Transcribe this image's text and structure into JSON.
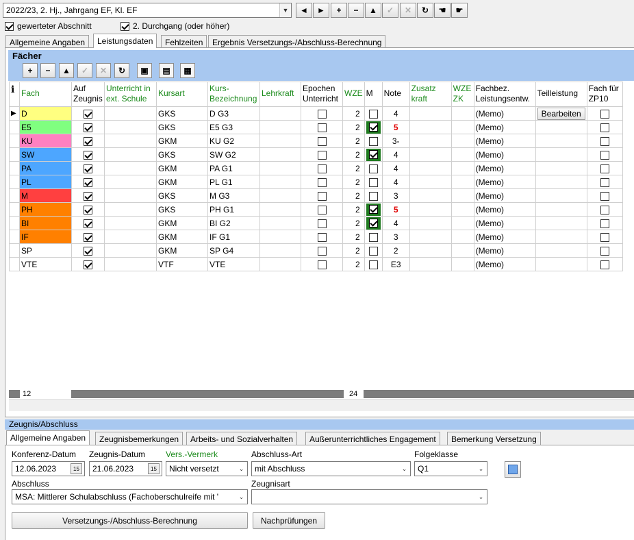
{
  "top": {
    "period_combo": "2022/23, 2. Hj., Jahrgang EF, Kl. EF",
    "nav_buttons": [
      "◄",
      "►",
      "+",
      "−",
      "▲",
      "✓",
      "✕",
      "↻",
      "☚",
      "☛"
    ],
    "chk_gewertet": "gewerteter Abschnitt",
    "chk_durchgang": "2. Durchgang (oder höher)"
  },
  "tabs": [
    "Allgemeine Angaben",
    "Leistungsdaten",
    "Fehlzeiten",
    "Ergebnis Versetzungs-/Abschluss-Berechnung"
  ],
  "faecher": {
    "title": "Fächer",
    "toolbar": [
      "+",
      "−",
      "▲",
      "✓",
      "✕",
      "↻",
      "▣",
      "▤",
      "▦"
    ],
    "headers": [
      "i",
      "Fach",
      "Auf Zeugnis",
      "Unterricht in ext. Schule",
      "Kursart",
      "Kurs-Bezeichnung",
      "Lehrkraft",
      "Epochen Unterricht",
      "WZE",
      "M",
      "Note",
      "Zusatz kraft",
      "WZE ZK",
      "Fachbez. Leistungsentw.",
      "Teilleistung",
      "Fach für ZP10"
    ],
    "bearbeiten": "Bearbeiten",
    "rows": [
      {
        "fach": "D",
        "color": "#ffff80",
        "kursart": "GKS",
        "kurs": "D  G3",
        "wze": "2",
        "m": false,
        "note": "4",
        "red": false,
        "memo": "(Memo)"
      },
      {
        "fach": "E5",
        "color": "#80ff80",
        "kursart": "GKS",
        "kurs": "E5 G3",
        "wze": "2",
        "m": true,
        "note": "5",
        "red": true,
        "memo": "(Memo)"
      },
      {
        "fach": "KU",
        "color": "#ff80c0",
        "kursart": "GKM",
        "kurs": "KU G2",
        "wze": "2",
        "m": false,
        "note": "3-",
        "red": false,
        "memo": "(Memo)"
      },
      {
        "fach": "SW",
        "color": "#4da6ff",
        "kursart": "GKS",
        "kurs": "SW G2",
        "wze": "2",
        "m": true,
        "note": "4",
        "red": false,
        "memo": "(Memo)"
      },
      {
        "fach": "PA",
        "color": "#4da6ff",
        "kursart": "GKM",
        "kurs": "PA G1",
        "wze": "2",
        "m": false,
        "note": "4",
        "red": false,
        "memo": "(Memo)"
      },
      {
        "fach": "PL",
        "color": "#4da6ff",
        "kursart": "GKM",
        "kurs": "PL G1",
        "wze": "2",
        "m": false,
        "note": "4",
        "red": false,
        "memo": "(Memo)"
      },
      {
        "fach": "M",
        "color": "#ff4040",
        "kursart": "GKS",
        "kurs": "M  G3",
        "wze": "2",
        "m": false,
        "note": "3",
        "red": false,
        "memo": "(Memo)"
      },
      {
        "fach": "PH",
        "color": "#ff8000",
        "kursart": "GKS",
        "kurs": "PH G1",
        "wze": "2",
        "m": true,
        "note": "5",
        "red": true,
        "memo": "(Memo)"
      },
      {
        "fach": "BI",
        "color": "#ff8000",
        "kursart": "GKM",
        "kurs": "BI G2",
        "wze": "2",
        "m": true,
        "note": "4",
        "red": false,
        "memo": "(Memo)"
      },
      {
        "fach": "IF",
        "color": "#ff8000",
        "kursart": "GKM",
        "kurs": "IF G1",
        "wze": "2",
        "m": false,
        "note": "3",
        "red": false,
        "memo": "(Memo)"
      },
      {
        "fach": "SP",
        "color": "#ffffff",
        "kursart": "GKM",
        "kurs": "SP G4",
        "wze": "2",
        "m": false,
        "note": "2",
        "red": false,
        "memo": "(Memo)"
      },
      {
        "fach": "VTE",
        "color": "#ffffff",
        "kursart": "VTF",
        "kurs": "VTE",
        "wze": "2",
        "m": false,
        "note": "E3",
        "red": false,
        "memo": "(Memo)"
      }
    ],
    "footer_count": "12",
    "footer_wze": "24"
  },
  "zeugnis": {
    "title": "Zeugnis/Abschluss",
    "tabs": [
      "Allgemeine Angaben",
      "Zeugnisbemerkungen",
      "Arbeits- und Sozialverhalten",
      "Außerunterrichtliches Engagement",
      "Bemerkung Versetzung"
    ],
    "konferenz_label": "Konferenz-Datum",
    "konferenz_value": "12.06.2023",
    "zeugnis_label": "Zeugnis-Datum",
    "zeugnis_value": "21.06.2023",
    "vers_label": "Vers.-Vermerk",
    "vers_value": "Nicht versetzt",
    "abschlussart_label": "Abschluss-Art",
    "abschlussart_value": "mit Abschluss",
    "folgeklasse_label": "Folgeklasse",
    "folgeklasse_value": "Q1",
    "abschluss_label": "Abschluss",
    "abschluss_value": "MSA: Mittlerer Schulabschluss (Fachoberschulreife mit '",
    "zeugnisart_label": "Zeugnisart",
    "zeugnisart_value": "",
    "btn_berechnung": "Versetzungs-/Abschluss-Berechnung",
    "btn_nachpruefungen": "Nachprüfungen"
  }
}
